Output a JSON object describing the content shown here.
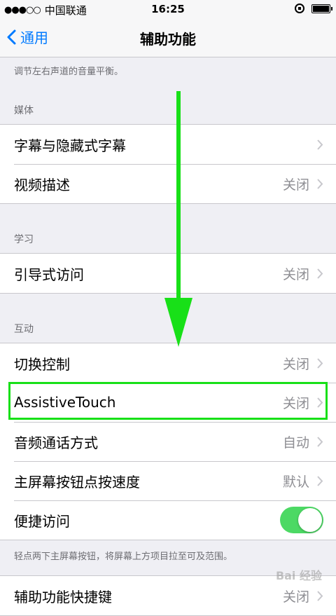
{
  "status_bar": {
    "signal_dots": "●●●○○",
    "carrier": "中国联通",
    "time": "16:25"
  },
  "nav": {
    "back_label": "通用",
    "title": "辅助功能"
  },
  "top_note": "调节左右声道的音量平衡。",
  "groups": {
    "media": {
      "header": "媒体",
      "rows": [
        {
          "label": "字幕与隐藏式字幕",
          "value": ""
        },
        {
          "label": "视频描述",
          "value": "关闭"
        }
      ]
    },
    "learning": {
      "header": "学习",
      "rows": [
        {
          "label": "引导式访问",
          "value": "关闭"
        }
      ]
    },
    "interaction": {
      "header": "互动",
      "rows": [
        {
          "label": "切换控制",
          "value": "关闭"
        },
        {
          "label": "AssistiveTouch",
          "value": "关闭"
        },
        {
          "label": "音频通话方式",
          "value": "自动"
        },
        {
          "label": "主屏幕按钮点按速度",
          "value": "默认"
        },
        {
          "label": "便捷访问",
          "toggle_on": true
        }
      ],
      "footer": "轻点两下主屏幕按钮，将屏幕上方项目拉至可及范围。"
    },
    "bottom": {
      "rows": [
        {
          "label": "辅助功能快捷键",
          "value": "关闭"
        }
      ]
    }
  },
  "watermark": "Bai 经验",
  "colors": {
    "accent": "#007aff",
    "toggle_on": "#4cd964",
    "annotation_green": "#18e018"
  }
}
